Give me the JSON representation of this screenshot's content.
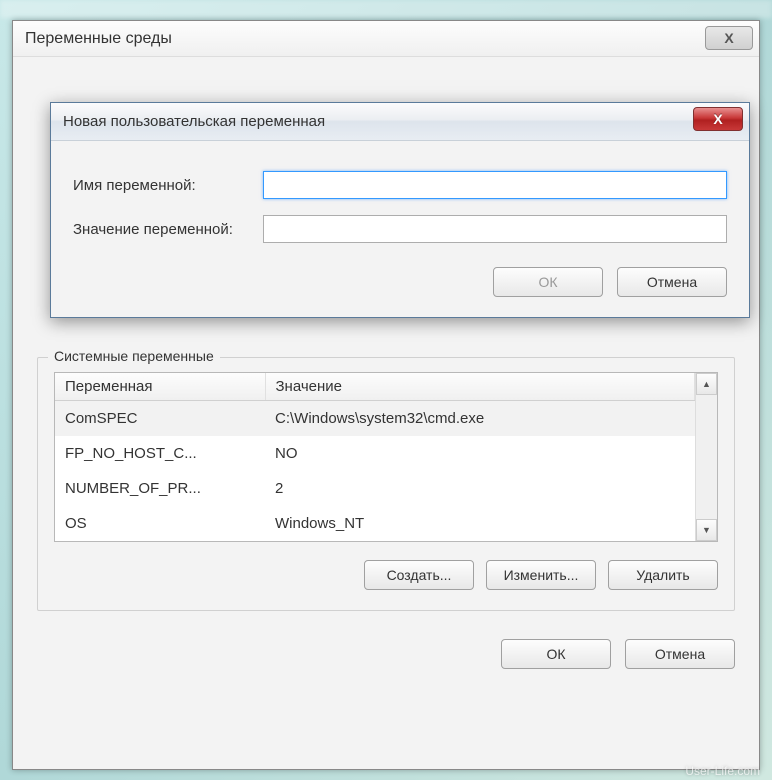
{
  "parent": {
    "title": "Переменные среды",
    "close_x": "X"
  },
  "modal": {
    "title": "Новая пользовательская переменная",
    "close_x": "X",
    "name_label": "Имя переменной:",
    "value_label": "Значение переменной:",
    "name_value": "",
    "value_value": "",
    "ok_label": "ОК",
    "cancel_label": "Отмена"
  },
  "system": {
    "group_title": "Системные переменные",
    "col_var": "Переменная",
    "col_val": "Значение",
    "rows": [
      {
        "var": "ComSPEC",
        "val": "C:\\Windows\\system32\\cmd.exe"
      },
      {
        "var": "FP_NO_HOST_C...",
        "val": "NO"
      },
      {
        "var": "NUMBER_OF_PR...",
        "val": "2"
      },
      {
        "var": "OS",
        "val": "Windows_NT"
      }
    ],
    "create_label": "Создать...",
    "edit_label": "Изменить...",
    "delete_label": "Удалить"
  },
  "footer": {
    "ok_label": "ОК",
    "cancel_label": "Отмена"
  },
  "scroll": {
    "up": "▲",
    "down": "▼"
  },
  "watermark": "User-Life.com"
}
